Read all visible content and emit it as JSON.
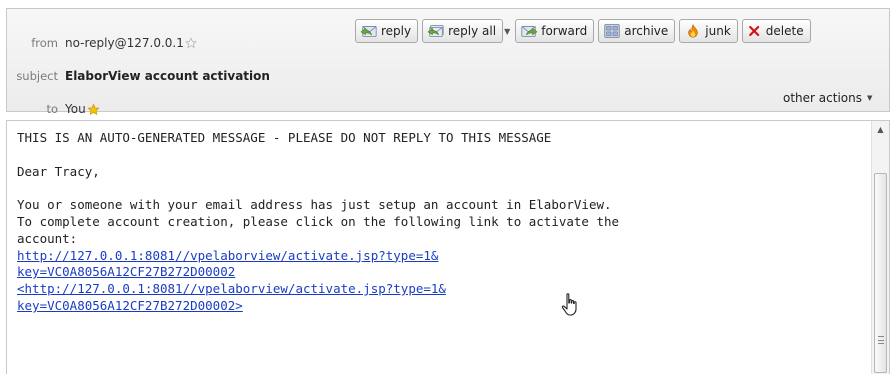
{
  "header": {
    "from_label": "from",
    "from_value": "no-reply@127.0.0.1",
    "subject_label": "subject",
    "subject_value": "ElaborView account activation",
    "to_label": "to",
    "to_value": "You"
  },
  "toolbar": {
    "reply": "reply",
    "reply_all": "reply all",
    "forward": "forward",
    "archive": "archive",
    "junk": "junk",
    "delete": "delete",
    "other_actions": "other actions"
  },
  "message": {
    "line1": "THIS IS AN AUTO-GENERATED MESSAGE - PLEASE DO NOT REPLY TO THIS MESSAGE",
    "line2": "Dear Tracy,",
    "line3": "You or someone with your email address has just setup an account in ElaborView.",
    "line4": "To complete account creation, please click on the following link to activate the",
    "line5": "account:",
    "link1_a": "http://127.0.0.1:8081//vpelaborview/activate.jsp?type=1&",
    "link1_b": "key=VC0A8056A12CF27B272D00002",
    "link2_a": "<http://127.0.0.1:8081//vpelaborview/activate.jsp?type=1&",
    "link2_b": "key=VC0A8056A12CF27B272D00002>"
  },
  "colors": {
    "link": "#1a3cc4",
    "header_bg": "#efefef",
    "star": "#f2b400",
    "delete_x": "#d01010"
  },
  "icons": [
    "star-outline-icon",
    "star-icon",
    "reply-icon",
    "reply-all-icon",
    "forward-icon",
    "archive-icon",
    "junk-icon",
    "delete-icon",
    "hand-cursor-icon"
  ]
}
